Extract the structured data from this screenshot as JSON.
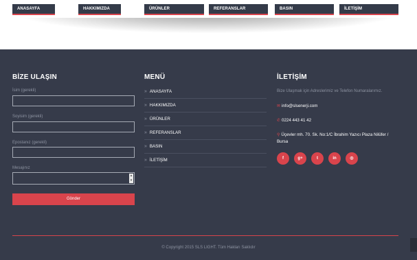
{
  "nav": {
    "items": [
      {
        "label": "ANASAYFA"
      },
      {
        "label": "HAKKIMIZDA"
      },
      {
        "label": "ÜRÜNLER"
      },
      {
        "label": "REFERANSLAR"
      },
      {
        "label": "BASIN"
      },
      {
        "label": "İLETİŞİM"
      }
    ]
  },
  "contact_form": {
    "title": "BİZE ULAŞIN",
    "name_label": "İsim (gerekli)",
    "surname_label": "Soyisim (gerekli)",
    "email_label": "Epostanız (gerekli)",
    "message_label": "Mesajınız",
    "submit_label": "Gönder"
  },
  "menu": {
    "title": "MENÜ",
    "items": [
      {
        "label": "ANASAYFA"
      },
      {
        "label": "HAKKIMIZDA"
      },
      {
        "label": "ÜRÜNLER"
      },
      {
        "label": "REFERANSLAR"
      },
      {
        "label": "BASIN"
      },
      {
        "label": "İLETİŞİM"
      }
    ]
  },
  "contact_info": {
    "title": "İLETİŞİM",
    "intro": "Bize Ulaşmak için Adreslerimiz ve Telefon Numaralarımız.",
    "email": "info@slsenerji.com",
    "phone": "0224 443 41 42",
    "address_line1": "Üçevler mh. 70. Sk. No:1/C İbrahim Yazıcı Plaza Nilüfer /",
    "address_line2": "Bursa"
  },
  "social": [
    {
      "icon": "facebook-icon",
      "glyph": "f"
    },
    {
      "icon": "google-plus-icon",
      "glyph": "g+"
    },
    {
      "icon": "twitter-icon",
      "glyph": "t"
    },
    {
      "icon": "linkedin-icon",
      "glyph": "in"
    },
    {
      "icon": "dribbble-icon",
      "glyph": "◎"
    }
  ],
  "footer": {
    "copyright": "© Copyright 2015 SLS LIGHT. Tüm Hakları Saklıdır"
  },
  "colors": {
    "accent": "#d9444c",
    "footer_bg": "#363b4a",
    "nav_bg": "#343b49"
  }
}
